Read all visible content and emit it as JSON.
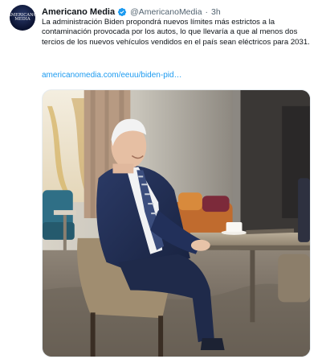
{
  "account": {
    "avatar_text": "AMERICANO MEDIA",
    "name": "Americano Media",
    "handle": "@AmericanoMedia",
    "separator": "·",
    "time": "3h"
  },
  "tweet": {
    "text": "La administración Biden propondrá nuevos límites más estrictos a la contaminación provocada por los autos, lo que llevaría a que al menos dos tercios de los nuevos vehículos vendidos en el país sean eléctricos para 2031.",
    "link": "americanomedia.com/eeuu/biden-pid…"
  },
  "colors": {
    "link": "#1d9bf0",
    "verified": "#1d9bf0",
    "secondary_text": "#536471"
  }
}
